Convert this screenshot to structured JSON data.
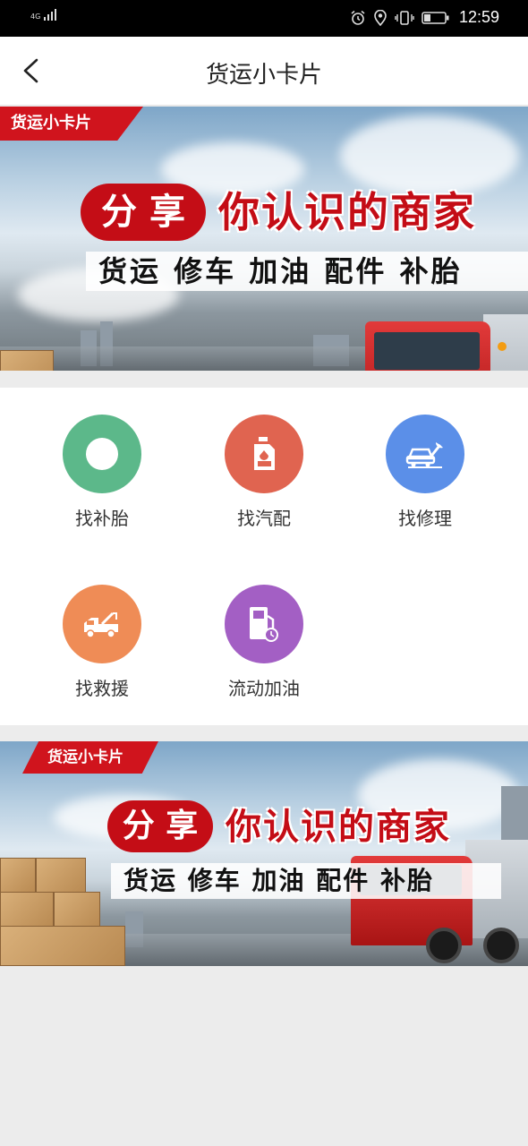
{
  "status_bar": {
    "network": "4G",
    "time": "12:59"
  },
  "header": {
    "title": "货运小卡片"
  },
  "banners": [
    {
      "tag": "货运小卡片",
      "share": "分 享",
      "headline": "你认识的商家",
      "services": "货运 修车 加油 配件 补胎"
    },
    {
      "tag": "货运小卡片",
      "share": "分 享",
      "headline": "你认识的商家",
      "services": "货运 修车 加油 配件 补胎"
    }
  ],
  "services": [
    {
      "label": "找补胎",
      "icon": "tire-icon",
      "color": "#5cb88a"
    },
    {
      "label": "找汽配",
      "icon": "oil-bottle-icon",
      "color": "#e06450"
    },
    {
      "label": "找修理",
      "icon": "car-wrench-icon",
      "color": "#5b8fe8"
    },
    {
      "label": "找救援",
      "icon": "tow-truck-icon",
      "color": "#ef8c56"
    },
    {
      "label": "流动加油",
      "icon": "fuel-pump-icon",
      "color": "#a35fc4"
    }
  ]
}
